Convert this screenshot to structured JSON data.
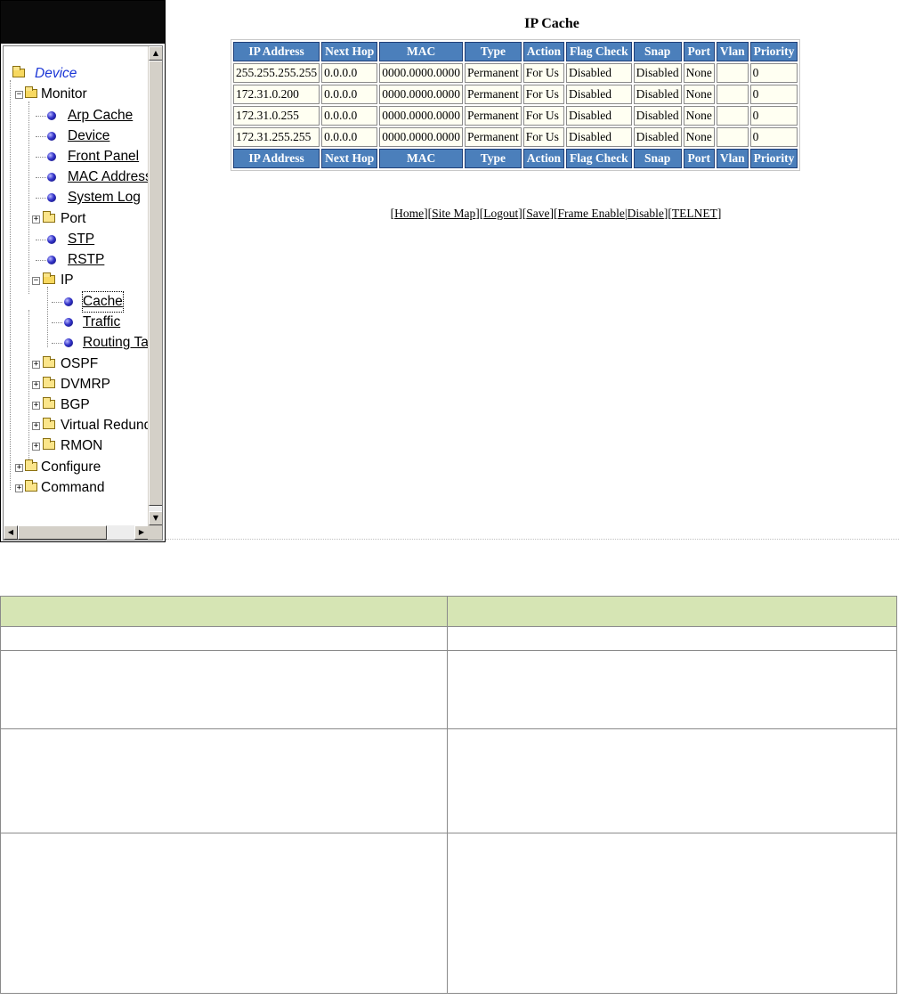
{
  "nav": {
    "tree": [
      {
        "label": "Device",
        "kind": "root"
      },
      {
        "label": "Monitor",
        "kind": "folder-open"
      },
      {
        "label": "Arp Cache",
        "kind": "link"
      },
      {
        "label": "Device",
        "kind": "link"
      },
      {
        "label": "Front Panel",
        "kind": "link"
      },
      {
        "label": "MAC Address",
        "kind": "link"
      },
      {
        "label": "System Log",
        "kind": "link"
      },
      {
        "label": "Port",
        "kind": "folder"
      },
      {
        "label": "STP",
        "kind": "link"
      },
      {
        "label": "RSTP",
        "kind": "link"
      },
      {
        "label": "IP",
        "kind": "folder-open"
      },
      {
        "label": "Cache",
        "kind": "link-selected"
      },
      {
        "label": "Traffic",
        "kind": "link"
      },
      {
        "label": "Routing Table",
        "kind": "link"
      },
      {
        "label": "OSPF",
        "kind": "folder"
      },
      {
        "label": "DVMRP",
        "kind": "folder"
      },
      {
        "label": "BGP",
        "kind": "folder"
      },
      {
        "label": "Virtual Redundancy",
        "kind": "folder"
      },
      {
        "label": "RMON",
        "kind": "folder"
      },
      {
        "label": "Configure",
        "kind": "folder"
      },
      {
        "label": "Command",
        "kind": "folder"
      }
    ]
  },
  "main": {
    "title": "IP Cache",
    "table": {
      "columns": [
        "IP Address",
        "Next Hop",
        "MAC",
        "Type",
        "Action",
        "Flag Check",
        "Snap",
        "Port",
        "Vlan",
        "Priority"
      ],
      "rows": [
        [
          "255.255.255.255",
          "0.0.0.0",
          "0000.0000.0000",
          "Permanent",
          "For Us",
          "Disabled",
          "Disabled",
          "None",
          "",
          "0"
        ],
        [
          "172.31.0.200",
          "0.0.0.0",
          "0000.0000.0000",
          "Permanent",
          "For Us",
          "Disabled",
          "Disabled",
          "None",
          "",
          "0"
        ],
        [
          "172.31.0.255",
          "0.0.0.0",
          "0000.0000.0000",
          "Permanent",
          "For Us",
          "Disabled",
          "Disabled",
          "None",
          "",
          "0"
        ],
        [
          "172.31.255.255",
          "0.0.0.0",
          "0000.0000.0000",
          "Permanent",
          "For Us",
          "Disabled",
          "Disabled",
          "None",
          "",
          "0"
        ]
      ]
    },
    "footer_links": [
      "Home",
      "Site Map",
      "Logout",
      "Save",
      "Frame Enable",
      "Disable",
      "TELNET"
    ]
  },
  "colors": {
    "table_header_bg": "#4b7fbb",
    "table_cell_bg": "#fffff2",
    "desc_header_bg": "#d6e5b4",
    "nav_header_bg": "#0a0a0a"
  }
}
